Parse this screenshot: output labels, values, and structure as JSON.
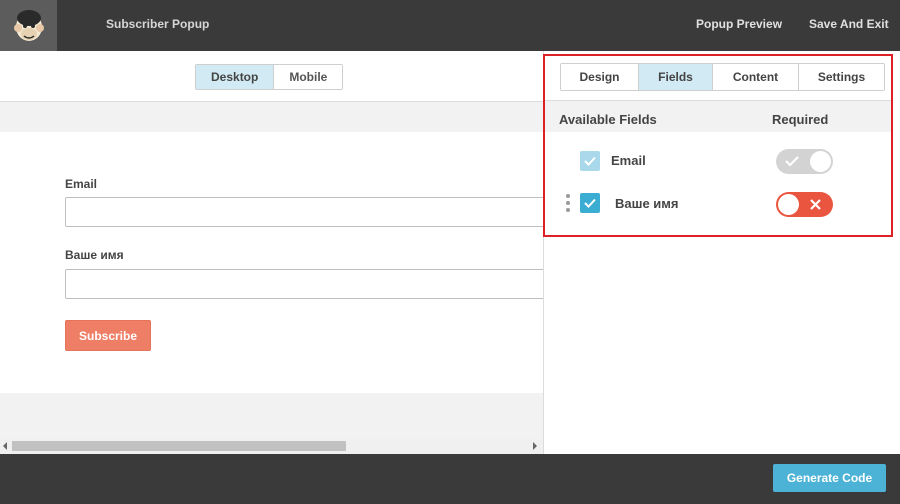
{
  "header": {
    "app_title": "Subscriber Popup",
    "popup_preview_label": "Popup Preview",
    "save_exit_label": "Save And Exit",
    "logo_icon": "mailchimp-logo-icon"
  },
  "preview": {
    "device_tabs": [
      {
        "label": "Desktop",
        "active": true
      },
      {
        "label": "Mobile",
        "active": false
      }
    ],
    "form": {
      "email_label": "Email",
      "email_value": "",
      "name_label": "Ваше имя",
      "name_value": "",
      "subscribe_label": "Subscribe"
    }
  },
  "panel": {
    "tabs": [
      {
        "label": "Design",
        "active": false
      },
      {
        "label": "Fields",
        "active": true
      },
      {
        "label": "Content",
        "active": false
      },
      {
        "label": "Settings",
        "active": false
      }
    ],
    "available_fields_header": "Available Fields",
    "required_header": "Required",
    "fields": [
      {
        "label": "Email",
        "checked": true,
        "required": true,
        "locked": true
      },
      {
        "label": "Ваше имя",
        "checked": true,
        "required": false,
        "locked": false
      }
    ],
    "highlight_color": "#dd1f26"
  },
  "footer": {
    "generate_code_label": "Generate Code"
  },
  "colors": {
    "accent_blue": "#4db3d6",
    "subscribe_coral": "#ee7e66",
    "toggle_red": "#e9553f",
    "bar_dark": "#3a3a3a"
  }
}
